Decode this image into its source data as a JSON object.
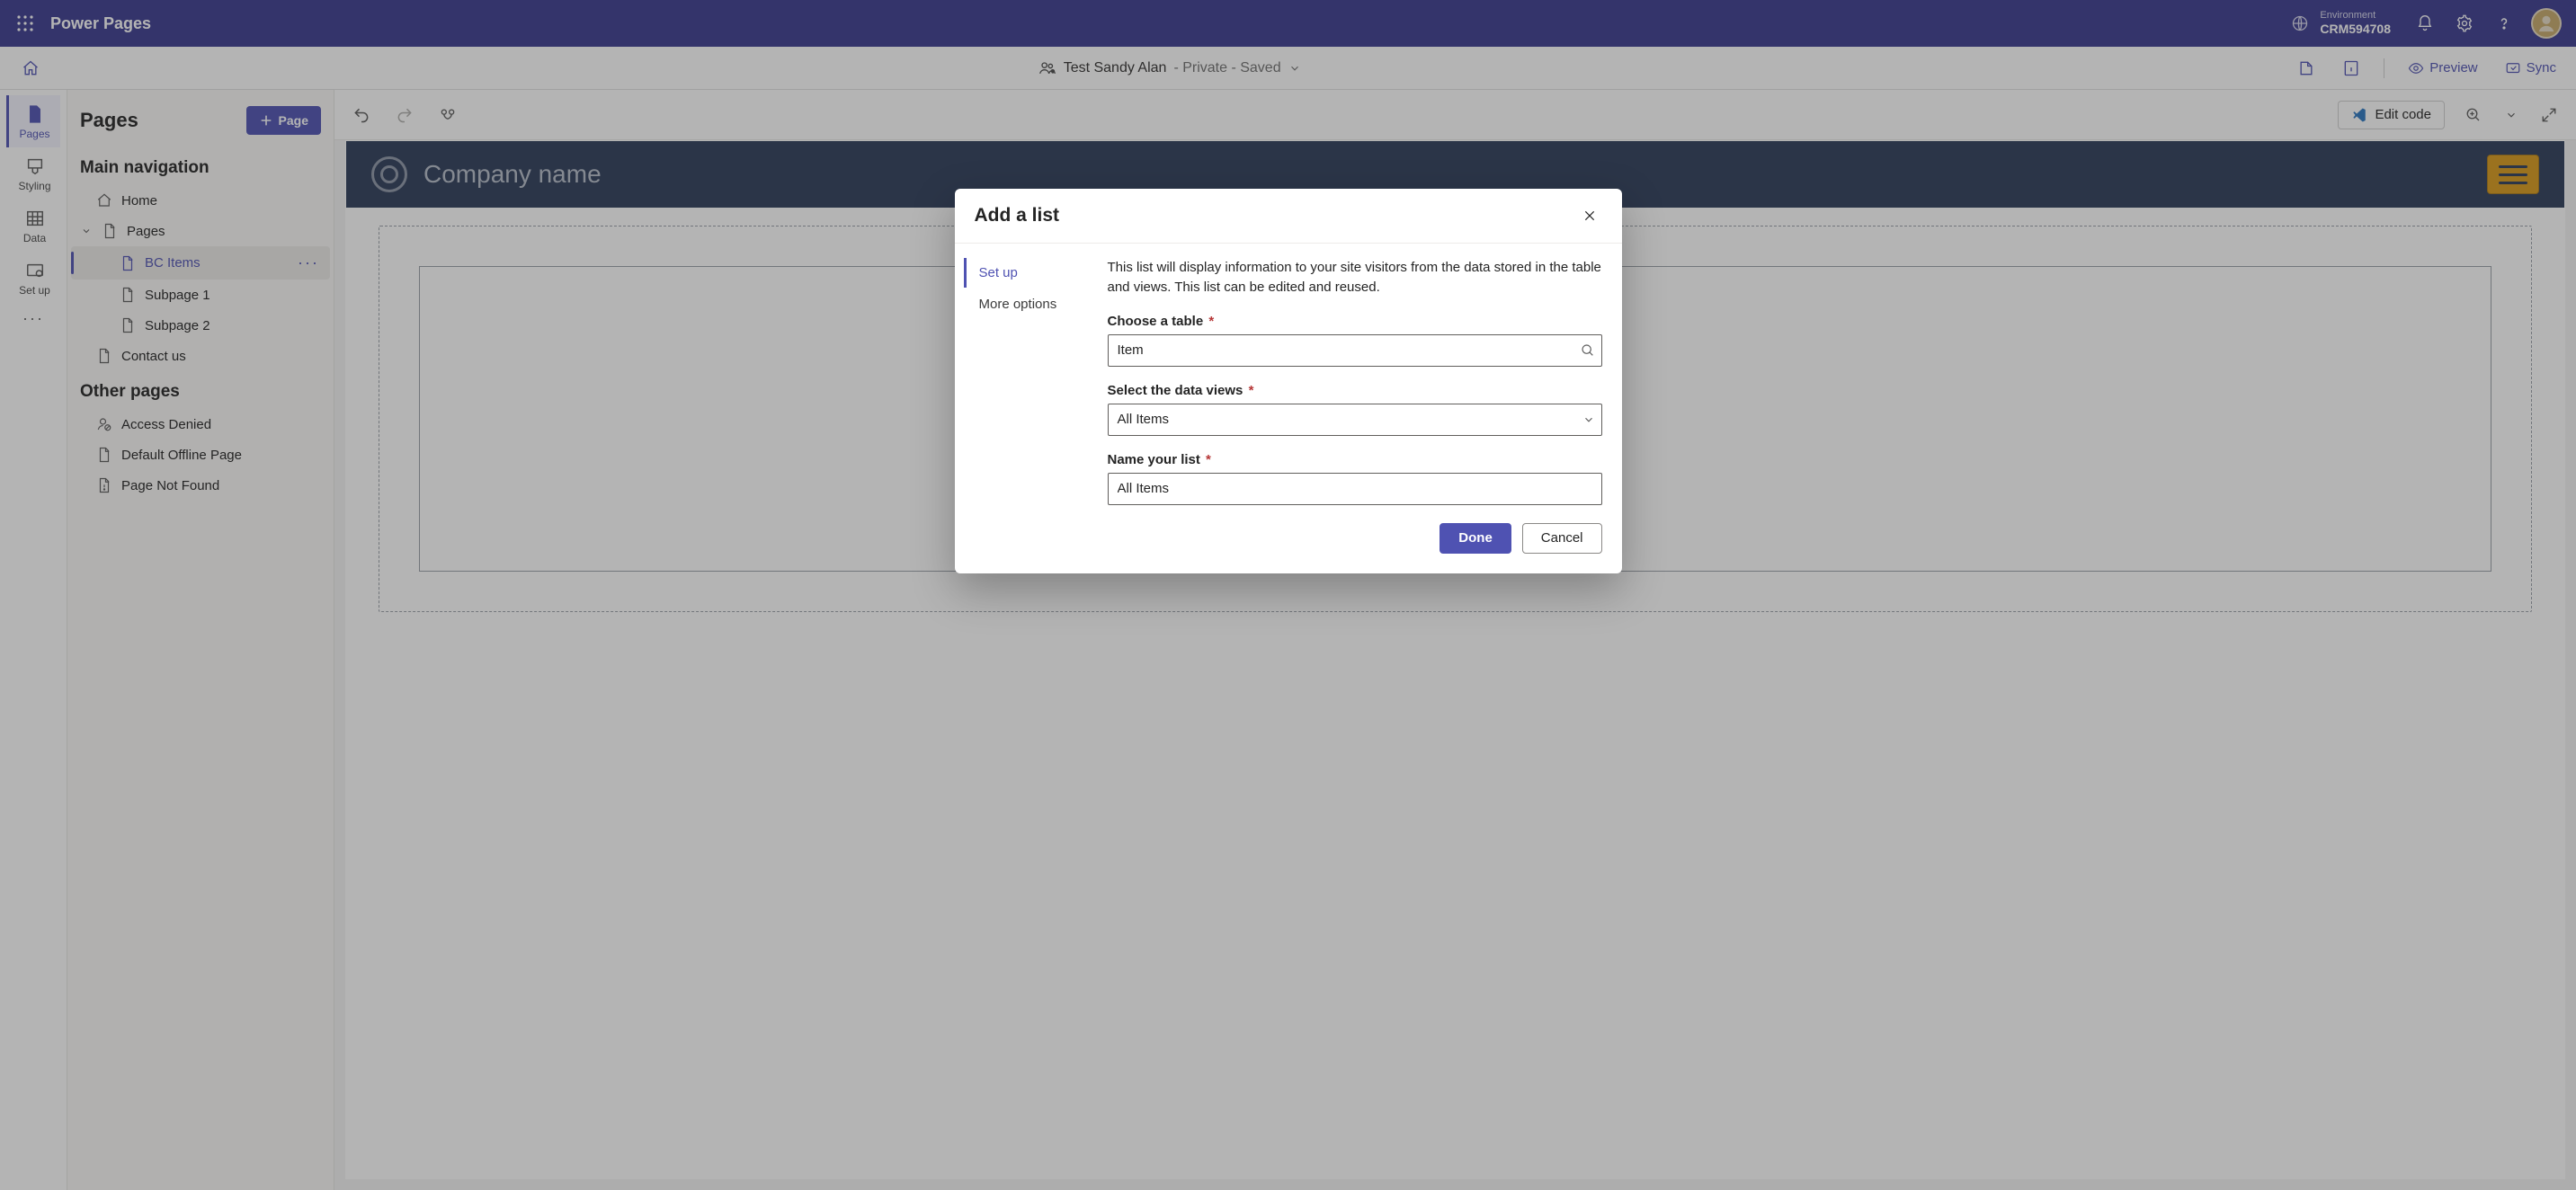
{
  "topbar": {
    "brand": "Power Pages",
    "environment_label": "Environment",
    "environment_value": "CRM594708"
  },
  "sitebar": {
    "site_name": "Test Sandy Alan",
    "site_meta": " - Private - Saved",
    "preview": "Preview",
    "sync": "Sync"
  },
  "rail": {
    "items": [
      {
        "label": "Pages"
      },
      {
        "label": "Styling"
      },
      {
        "label": "Data"
      },
      {
        "label": "Set up"
      }
    ]
  },
  "side": {
    "title": "Pages",
    "add_page": "Page",
    "section_main": "Main navigation",
    "section_other": "Other pages",
    "tree_home": "Home",
    "tree_pages": "Pages",
    "tree_bcitems": "BC Items",
    "tree_sub1": "Subpage 1",
    "tree_sub2": "Subpage 2",
    "tree_contact": "Contact us",
    "other_access": "Access Denied",
    "other_offline": "Default Offline Page",
    "other_notfound": "Page Not Found"
  },
  "toolbar": {
    "edit_code": "Edit code"
  },
  "preview_site": {
    "company_name": "Company name"
  },
  "modal": {
    "title": "Add a list",
    "nav_setup": "Set up",
    "nav_more": "More options",
    "description": "This list will display information to your site visitors from the data stored in the table and views. This list can be edited and reused.",
    "label_table": "Choose a table",
    "value_table": "Item",
    "label_views": "Select the data views",
    "value_views": "All Items",
    "label_name": "Name your list",
    "value_name": "All Items",
    "btn_done": "Done",
    "btn_cancel": "Cancel"
  }
}
